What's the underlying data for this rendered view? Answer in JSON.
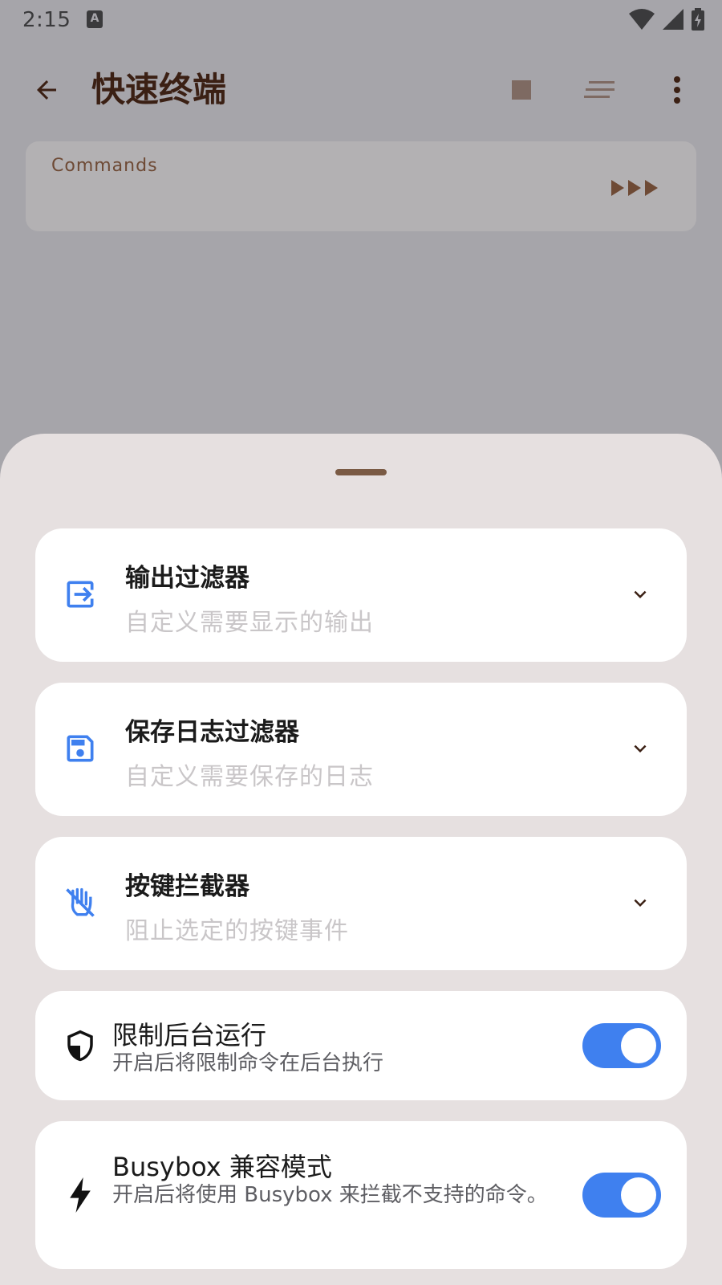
{
  "status_bar": {
    "time": "2:15",
    "notif_icon": "A"
  },
  "app_bar": {
    "title": "快速终端"
  },
  "commands": {
    "label": "Commands"
  },
  "sheet": {
    "cards": [
      {
        "title": "输出过滤器",
        "subtitle": "自定义需要显示的输出",
        "icon": "output-icon"
      },
      {
        "title": "保存日志过滤器",
        "subtitle": "自定义需要保存的日志",
        "icon": "save-icon"
      },
      {
        "title": "按键拦截器",
        "subtitle": "阻止选定的按键事件",
        "icon": "do-not-touch-icon"
      }
    ],
    "toggles": [
      {
        "title": "限制后台运行",
        "subtitle": "开启后将限制命令在后台执行",
        "enabled": true,
        "icon": "shield-icon"
      },
      {
        "title": "Busybox 兼容模式",
        "subtitle": "开启后将使用 Busybox 来拦截不支持的命令。",
        "enabled": true,
        "icon": "bolt-icon"
      }
    ]
  },
  "colors": {
    "accent": "#3f80ef",
    "title_brown": "#3b2014",
    "sheet_bg": "#e6e0e0"
  }
}
